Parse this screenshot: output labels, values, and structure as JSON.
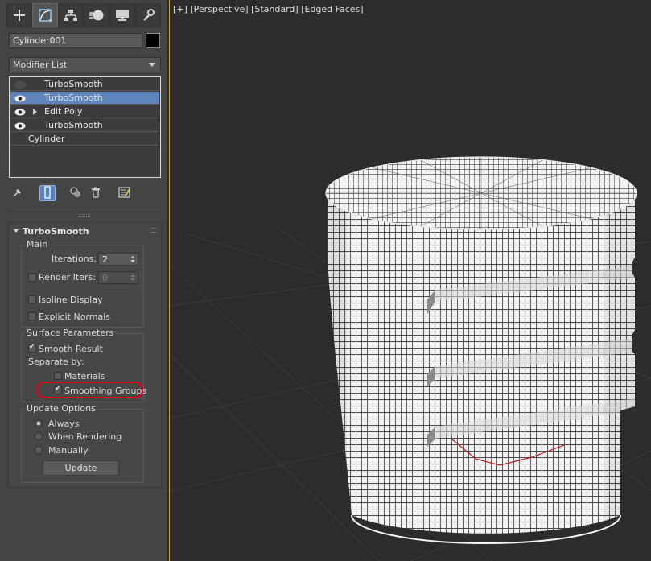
{
  "panel": {
    "tabs": [
      {
        "name": "create-tab",
        "icon": "plus-icon"
      },
      {
        "name": "modify-tab",
        "icon": "modify-curve-icon"
      },
      {
        "name": "hierarchy-tab",
        "icon": "hierarchy-icon"
      },
      {
        "name": "motion-tab",
        "icon": "motion-icon"
      },
      {
        "name": "display-tab",
        "icon": "monitor-icon"
      },
      {
        "name": "utilities-tab",
        "icon": "wrench-icon"
      }
    ],
    "object_name": "Cylinder001",
    "object_color": "#000000",
    "modifier_list_label": "Modifier List",
    "stack": [
      {
        "label": "TurboSmooth",
        "eye": "off",
        "expand": false,
        "selected": false
      },
      {
        "label": "TurboSmooth",
        "eye": "on",
        "expand": false,
        "selected": true
      },
      {
        "label": "Edit Poly",
        "eye": "on",
        "expand": true,
        "selected": false
      },
      {
        "label": "TurboSmooth",
        "eye": "on",
        "expand": false,
        "selected": false
      },
      {
        "label": "Cylinder",
        "eye": "none",
        "expand": false,
        "selected": false
      }
    ],
    "stack_tools": [
      "pin-icon",
      "show-end-result-icon",
      "make-unique-icon",
      "trash-icon",
      "configure-sets-icon"
    ]
  },
  "turbosmooth": {
    "title": "TurboSmooth",
    "main": {
      "title": "Main",
      "iterations_label": "Iterations:",
      "iterations_value": "2",
      "render_iters_label": "Render Iters:",
      "render_iters_value": "0",
      "render_iters_checked": false,
      "isoline_label": "Isoline Display",
      "isoline_checked": false,
      "explicit_normals_label": "Explicit Normals",
      "explicit_normals_checked": false
    },
    "surface": {
      "title": "Surface Parameters",
      "smooth_result_label": "Smooth Result",
      "smooth_result_checked": true,
      "separate_by_label": "Separate by:",
      "materials_label": "Materials",
      "materials_checked": false,
      "smoothing_groups_label": "Smoothing Groups",
      "smoothing_groups_checked": true
    },
    "update": {
      "title": "Update Options",
      "always_label": "Always",
      "when_rendering_label": "When Rendering",
      "manually_label": "Manually",
      "selected": "Always",
      "update_button_label": "Update"
    }
  },
  "viewport": {
    "label": "[+] [Perspective] [Standard] [Edged Faces]",
    "accent_color": "#c8a23c",
    "highlight_color": "#e0001b"
  }
}
